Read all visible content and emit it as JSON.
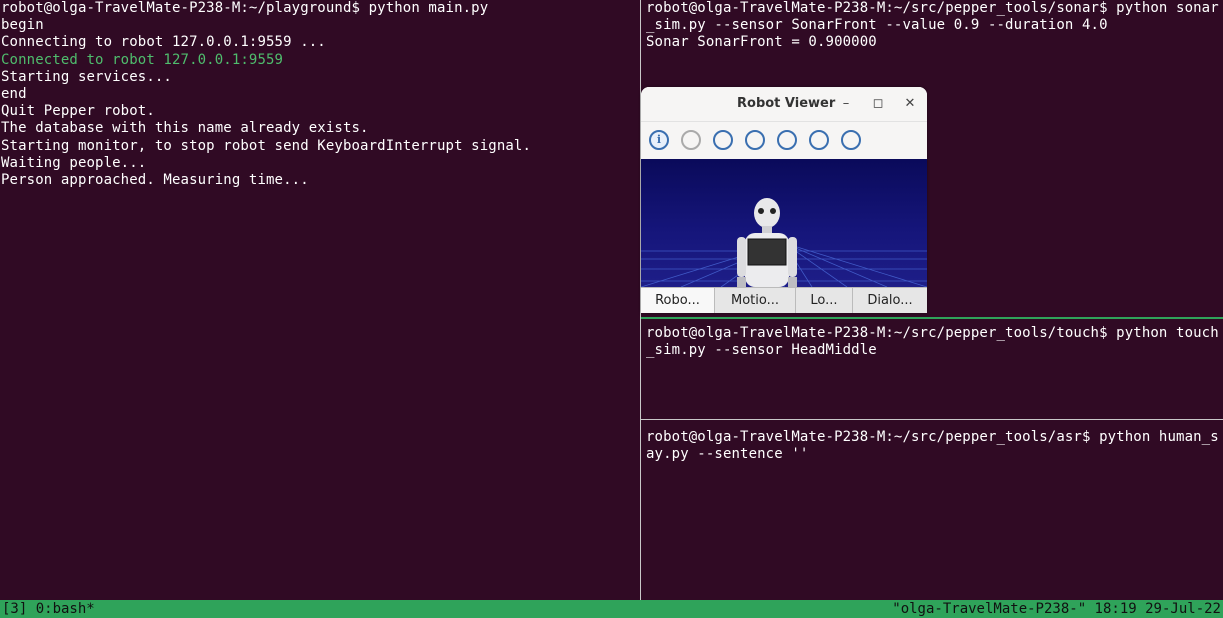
{
  "left_pane": {
    "lines": [
      {
        "text": "robot@olga-TravelMate-P238-M:~/playground$ python main.py",
        "color": "white"
      },
      {
        "text": "begin",
        "color": "white"
      },
      {
        "text": "Connecting to robot 127.0.0.1:9559 ...",
        "color": "white"
      },
      {
        "text": "Connected to robot 127.0.0.1:9559",
        "color": "green"
      },
      {
        "text": "Starting services...",
        "color": "white"
      },
      {
        "text": "end",
        "color": "white"
      },
      {
        "text": "Quit Pepper robot.",
        "color": "white"
      },
      {
        "text": "The database with this name already exists.",
        "color": "white"
      },
      {
        "text": "Starting monitor, to stop robot send KeyboardInterrupt signal.",
        "color": "white"
      },
      {
        "text": "Waiting people...",
        "color": "white"
      },
      {
        "text": "Person approached. Measuring time...",
        "color": "white"
      }
    ]
  },
  "top_right_pane": {
    "lines": [
      "robot@olga-TravelMate-P238-M:~/src/pepper_tools/sonar$ python sonar",
      "_sim.py --sensor SonarFront --value 0.9 --duration 4.0",
      "Sonar SonarFront = 0.900000"
    ]
  },
  "middle_right_pane": {
    "lines": [
      "robot@olga-TravelMate-P238-M:~/src/pepper_tools/touch$ python touch",
      "_sim.py --sensor HeadMiddle"
    ]
  },
  "bottom_right_pane": {
    "lines": [
      "robot@olga-TravelMate-P238-M:~/src/pepper_tools/asr$ python human_s",
      "ay.py --sentence ''"
    ]
  },
  "status_bar": {
    "left": "[3] 0:bash*",
    "right": "\"olga-TravelMate-P238-\" 18:19 29-Jul-22"
  },
  "robot_viewer": {
    "title": "Robot Viewer",
    "minimize_glyph": "–",
    "maximize_glyph": "◻",
    "close_glyph": "✕",
    "toolbar_icons": [
      "info-icon",
      "joints-icon",
      "camera-icon",
      "sparkle-icon",
      "gear-icon",
      "sonar-icon",
      "face-icon"
    ],
    "info_glyph": "i",
    "tabs": [
      "Robo...",
      "Motio...",
      "Lo...",
      "Dialo..."
    ],
    "active_tab": "Robo..."
  },
  "colors": {
    "terminal_bg": "#300a24",
    "terminal_text": "#ffffff",
    "connected_green": "#4fbd6d",
    "status_bar_bg": "#2fa35a",
    "scene_bg": "#12127a"
  }
}
